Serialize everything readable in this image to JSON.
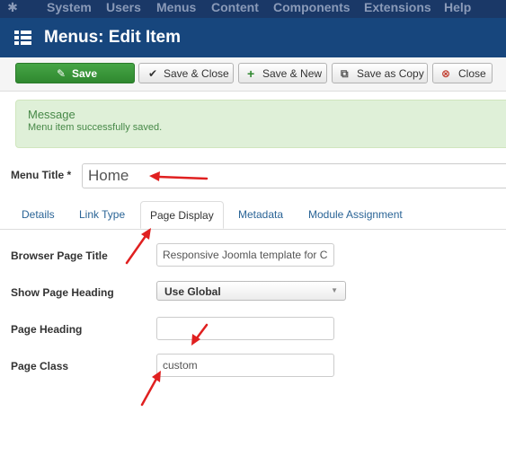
{
  "topbar": {
    "logo_icon": "joomla-logo-icon",
    "items": [
      "System",
      "Users",
      "Menus",
      "Content",
      "Components",
      "Extensions",
      "Help"
    ]
  },
  "header": {
    "icon": "list-icon",
    "title": "Menus: Edit Item"
  },
  "toolbar": {
    "save": "Save",
    "save_close": "Save & Close",
    "save_new": "Save & New",
    "save_copy": "Save as Copy",
    "close": "Close"
  },
  "alert": {
    "heading": "Message",
    "message": "Menu item successfully saved."
  },
  "menu_title": {
    "label": "Menu Title *",
    "value": "Home"
  },
  "tabs": [
    {
      "label": "Details"
    },
    {
      "label": "Link Type"
    },
    {
      "label": "Page Display"
    },
    {
      "label": "Metadata"
    },
    {
      "label": "Module Assignment"
    }
  ],
  "form": {
    "browser_title": {
      "label": "Browser Page Title",
      "value": "Responsive Joomla template for C"
    },
    "show_heading": {
      "label": "Show Page Heading",
      "value": "Use Global"
    },
    "page_heading": {
      "label": "Page Heading",
      "value": ""
    },
    "page_class": {
      "label": "Page Class",
      "value": "custom"
    }
  },
  "colors": {
    "topbar": "#1a3867",
    "header": "#17467d",
    "success": "#46a546",
    "alert_bg": "#dff0d8",
    "arrow": "#e02020"
  }
}
